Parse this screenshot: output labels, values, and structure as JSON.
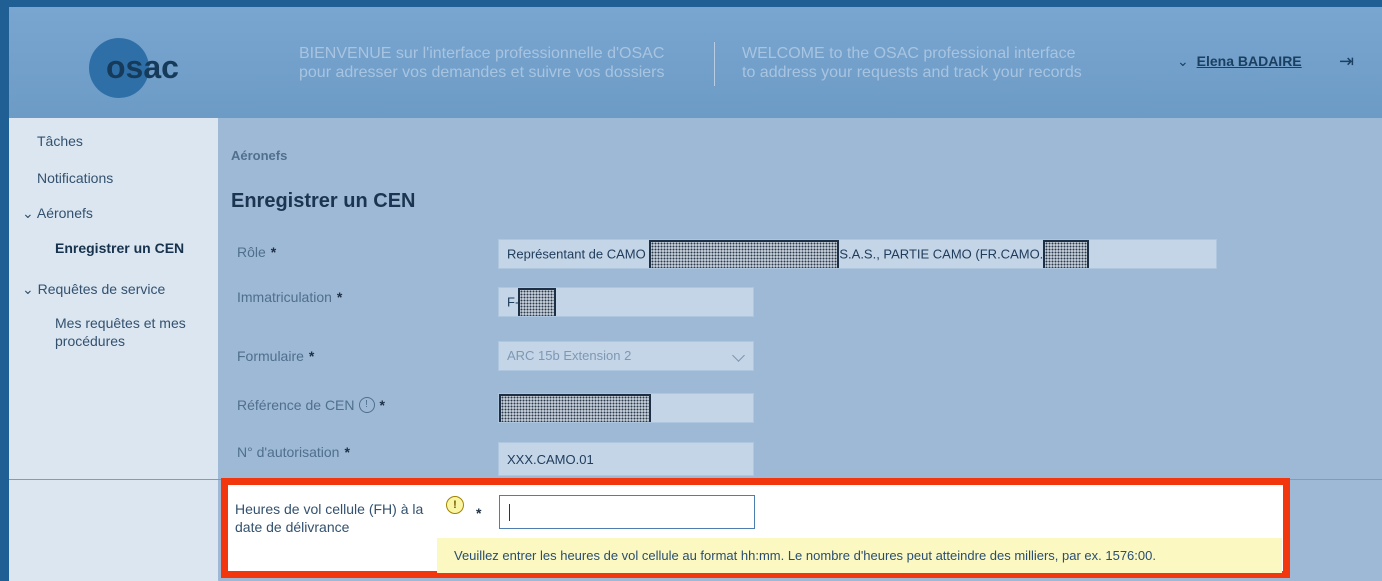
{
  "header": {
    "logo_text": "osac",
    "welcome_fr_line1": "BIENVENUE sur l'interface professionnelle d'OSAC",
    "welcome_fr_line2": "pour adresser vos demandes et suivre vos dossiers",
    "welcome_en_line1": "WELCOME to the OSAC professional interface",
    "welcome_en_line2": "to address your requests and track your records",
    "user_name": "Elena BADAIRE",
    "user_chevron": "⌄",
    "logout_icon": "logout-icon",
    "logout_glyph": "⇥"
  },
  "sidebar": {
    "items": [
      {
        "label": "Tâches"
      },
      {
        "label": "Notifications"
      },
      {
        "label": "Aéronefs",
        "expanded": true,
        "chevron": "⌄"
      },
      {
        "label": "Enregistrer un CEN",
        "active": true
      },
      {
        "label": "Requêtes de service",
        "expanded": true,
        "chevron": "⌄"
      },
      {
        "label": "Mes requêtes et mes procédures"
      }
    ]
  },
  "main": {
    "breadcrumb": "Aéronefs",
    "title": "Enregistrer un CEN",
    "required_mark": "*",
    "fields": {
      "role": {
        "label": "Rôle",
        "value_prefix": "Représentant de CAMO",
        "value_suffix": "S.A.S., PARTIE CAMO (FR.CAMO."
      },
      "immatriculation": {
        "label": "Immatriculation",
        "value_prefix": "F-"
      },
      "formulaire": {
        "label": "Formulaire",
        "value": "ARC 15b Extension 2"
      },
      "reference_cen": {
        "label": "Référence de CEN",
        "info_glyph": "!"
      },
      "autorisation": {
        "label": "N° d'autorisation",
        "value": "XXX.CAMO.01"
      },
      "heures_vol": {
        "label": "Heures de vol cellule (FH) à la date de délivrance",
        "warn_glyph": "!",
        "value": ""
      }
    },
    "tooltip": "Veuillez entrer les heures de vol cellule au format hh:mm. Le nombre d'heures peut atteindre des milliers, par ex. 1576:00."
  },
  "colors": {
    "highlight_border": "#f2370f",
    "tooltip_bg": "#fbf8c1",
    "header_bg": "#6c9bc6"
  }
}
